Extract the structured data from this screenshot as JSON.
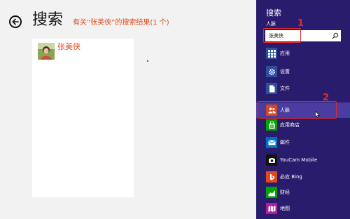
{
  "page": {
    "title": "搜索",
    "result_summary": "有关“张美侠”的搜索结果(1 个)"
  },
  "results": [
    {
      "name": "张美侠",
      "avatar_icon": "contact-photo"
    }
  ],
  "charm": {
    "title": "搜索",
    "scope_label": "人脉",
    "search_value": "张美侠",
    "apps": [
      {
        "label": "应用",
        "icon": "apps-icon",
        "color": "#2d4fa0",
        "selected": false
      },
      {
        "label": "设置",
        "icon": "gear-icon",
        "color": "#2d4fa0",
        "selected": false
      },
      {
        "label": "文件",
        "icon": "file-icon",
        "color": "#2d4fa0",
        "selected": false
      },
      {
        "label": "人脉",
        "icon": "people-icon",
        "color": "#d24726",
        "selected": true
      },
      {
        "label": "应用商店",
        "icon": "store-icon",
        "color": "#00a300",
        "selected": false
      },
      {
        "label": "邮件",
        "icon": "mail-icon",
        "color": "#0072c6",
        "selected": false
      },
      {
        "label": "YouCam Mobile",
        "icon": "camera-icon",
        "color": "#111111",
        "selected": false
      },
      {
        "label": "必应 Bing",
        "icon": "bing-icon",
        "color": "#e0491f",
        "selected": false
      },
      {
        "label": "财经",
        "icon": "finance-icon",
        "color": "#00a300",
        "selected": false
      },
      {
        "label": "地图",
        "icon": "maps-icon",
        "color": "#b01e9a",
        "selected": false
      }
    ]
  },
  "annotations": {
    "callout_1": "1",
    "callout_2": "2"
  },
  "colors": {
    "charm_background": "#2a1c6d",
    "accent_orange": "#e0491f",
    "selected_row": "#4a3ca0",
    "callout_red": "#e02b2b"
  }
}
